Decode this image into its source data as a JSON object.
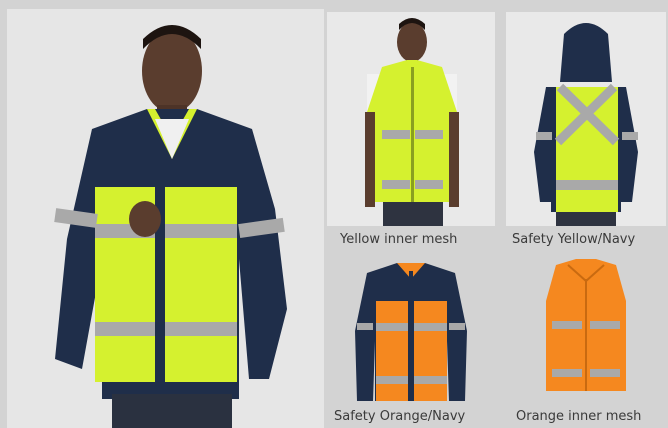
{
  "captions": {
    "yellow_mesh": "Yellow inner mesh",
    "safety_yellow_navy": "Safety Yellow/Navy",
    "safety_orange_navy": "Safety Orange/Navy",
    "orange_mesh": "Orange inner mesh"
  },
  "colors": {
    "navy": "#1f2e4a",
    "yellow": "#d5f12f",
    "orange": "#f5881f",
    "reflective": "#a9a9a9",
    "skin": "#5a3d2e"
  }
}
